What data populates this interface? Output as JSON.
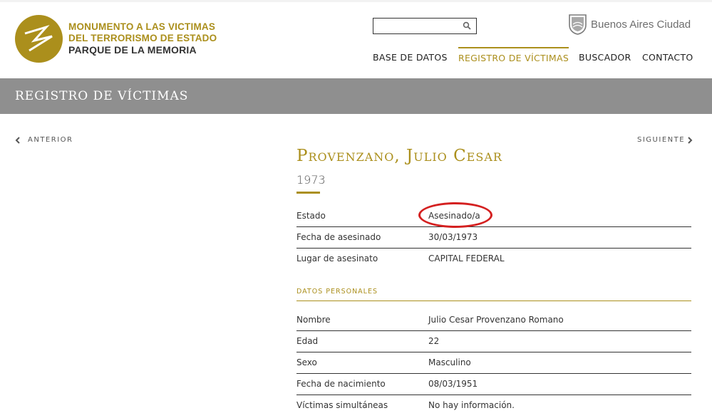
{
  "header": {
    "brand_line1": "MONUMENTO A LAS VICTIMAS",
    "brand_line2": "DEL TERRORISMO DE ESTADO",
    "brand_line3": "PARQUE DE LA MEMORIA",
    "search": {
      "value": "",
      "placeholder": ""
    },
    "city_name": "Buenos Aires Ciudad",
    "nav": [
      {
        "label": "BASE DE DATOS",
        "active": false
      },
      {
        "label": "REGISTRO DE VÍCTIMAS",
        "active": true
      },
      {
        "label": "BUSCADOR",
        "active": false
      },
      {
        "label": "CONTACTO",
        "active": false
      }
    ]
  },
  "band": {
    "title": "REGISTRO DE VÍCTIMAS"
  },
  "pager": {
    "prev_label": "ANTERIOR",
    "next_label": "SIGUIENTE"
  },
  "victim": {
    "name": "Provenzano, Julio Cesar",
    "year": "1973",
    "facts": [
      {
        "label": "Estado",
        "value": "Asesinado/a"
      },
      {
        "label": "Fecha de asesinado",
        "value": "30/03/1973"
      },
      {
        "label": "Lugar de asesinato",
        "value": "CAPITAL FEDERAL"
      }
    ],
    "personal_section_title": "DATOS PERSONALES",
    "personal": [
      {
        "label": "Nombre",
        "value": "Julio Cesar Provenzano Romano"
      },
      {
        "label": "Edad",
        "value": "22"
      },
      {
        "label": "Sexo",
        "value": "Masculino"
      },
      {
        "label": "Fecha de nacimiento",
        "value": "08/03/1951"
      },
      {
        "label": "Víctimas simultáneas",
        "value": "No hay información."
      }
    ]
  },
  "colors": {
    "accent": "#ab8f1c",
    "band": "#8f8f8f",
    "highlight": "#d42020"
  },
  "icons": {
    "logo": "zigzag-logo",
    "search": "search-icon",
    "city": "city-seal-icon",
    "prev": "chevron-left-icon",
    "next": "chevron-right-icon"
  }
}
